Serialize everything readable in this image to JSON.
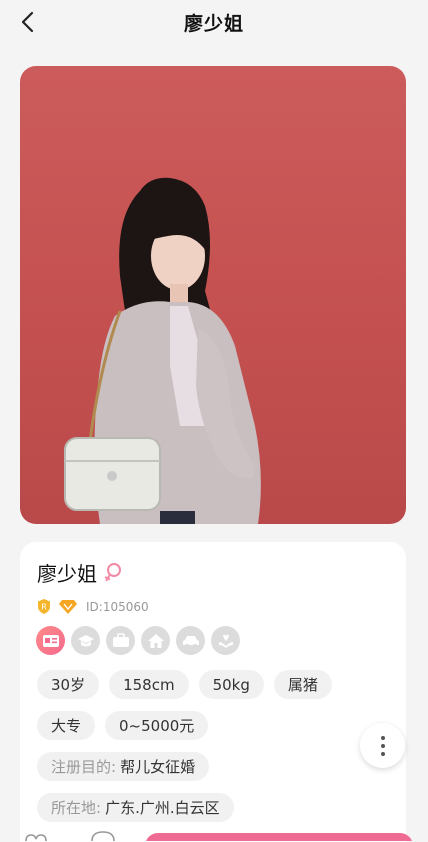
{
  "header": {
    "title": "廖少姐"
  },
  "profile": {
    "name": "廖少姐",
    "id_text": "ID:105060",
    "tags_row1": [
      "30岁",
      "158cm",
      "50kg",
      "属猪"
    ],
    "tags_row2": [
      "大专",
      "0~5000元"
    ],
    "purpose_label": "注册目的:",
    "purpose_value": "帮儿女征婚",
    "location_label": "所在地:",
    "location_value": "广东.广州.白云区"
  },
  "colors": {
    "photo_bg": "#c95657",
    "accent_pink": "#f06b93",
    "tag_bg": "#f1f1f1"
  },
  "icons": [
    "back-arrow-icon",
    "female-icon",
    "shield-badge-icon",
    "diamond-badge-icon",
    "id-card-icon",
    "education-icon",
    "briefcase-icon",
    "house-icon",
    "car-icon",
    "heart-hand-icon",
    "more-vertical-icon"
  ]
}
